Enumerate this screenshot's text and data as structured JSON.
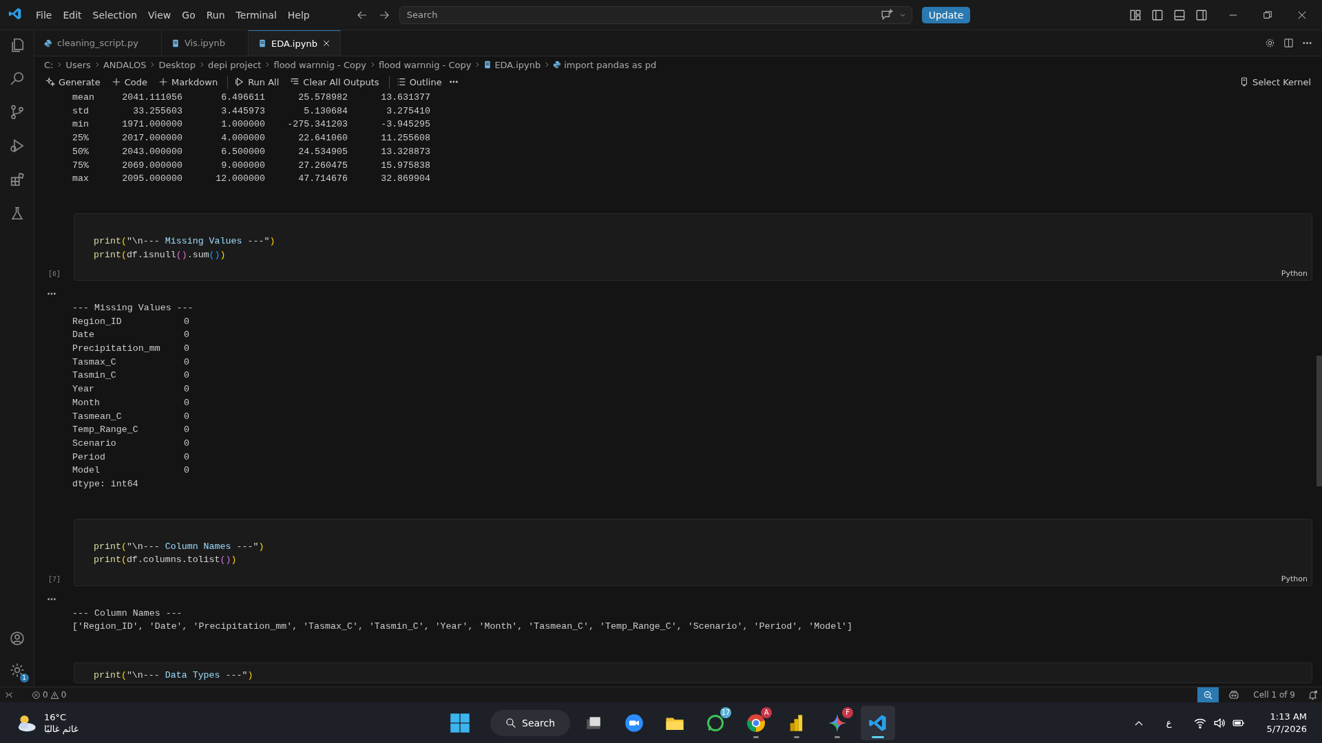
{
  "title_bar": {
    "menus": [
      "File",
      "Edit",
      "Selection",
      "View",
      "Go",
      "Run",
      "Terminal",
      "Help"
    ],
    "search": {
      "placeholder": "Search"
    },
    "update_button": "Update"
  },
  "activity_bar": {
    "items": [
      {
        "kind": "files",
        "selected": false
      },
      {
        "kind": "search",
        "selected": false
      },
      {
        "kind": "source-control",
        "selected": false
      },
      {
        "kind": "run-debug",
        "selected": false
      },
      {
        "kind": "extensions",
        "selected": false
      },
      {
        "kind": "testing",
        "selected": false
      }
    ],
    "settings_badge": "1"
  },
  "tabs": [
    {
      "label": "cleaning_script.py",
      "kind": "python",
      "selected": false
    },
    {
      "label": "Vis.ipynb",
      "kind": "notebook",
      "selected": false
    },
    {
      "label": "EDA.ipynb",
      "kind": "notebook",
      "selected": true
    }
  ],
  "breadcrumbs": [
    {
      "label": "C:",
      "kind": "folder"
    },
    {
      "label": "Users",
      "kind": "folder"
    },
    {
      "label": "ANDALOS",
      "kind": "folder"
    },
    {
      "label": "Desktop",
      "kind": "folder"
    },
    {
      "label": "depi project",
      "kind": "folder"
    },
    {
      "label": "flood warnnig - Copy",
      "kind": "folder"
    },
    {
      "label": "flood warnnig - Copy",
      "kind": "folder"
    },
    {
      "label": "EDA.ipynb",
      "kind": "notebook"
    },
    {
      "label": "import pandas as pd",
      "kind": "python"
    }
  ],
  "toolbar": [
    {
      "label": "Generate",
      "kind": "sparkle"
    },
    {
      "label": "Code",
      "kind": "plus"
    },
    {
      "label": "Markdown",
      "kind": "plus"
    },
    {
      "label": "Run All",
      "kind": "run",
      "divider": true
    },
    {
      "label": "Clear All Outputs",
      "kind": "clear"
    },
    {
      "label": "Outline",
      "kind": "list",
      "divider": true
    }
  ],
  "kernel_button": "Select Kernel",
  "notebook": [
    {
      "kind": "table_output",
      "rows": [
        [
          "mean",
          "2041.111056",
          "6.496611",
          "25.578982",
          "13.631377"
        ],
        [
          "std",
          "33.255603",
          "3.445973",
          "5.130684",
          "3.275410"
        ],
        [
          "min",
          "1971.000000",
          "1.000000",
          "-275.341203",
          "-3.945295"
        ],
        [
          "25%",
          "2017.000000",
          "4.000000",
          "22.641060",
          "11.255608"
        ],
        [
          "50%",
          "2043.000000",
          "6.500000",
          "24.534905",
          "13.328873"
        ],
        [
          "75%",
          "2069.000000",
          "9.000000",
          "27.260475",
          "15.975838"
        ],
        [
          "max",
          "2095.000000",
          "12.000000",
          "47.714676",
          "32.869904"
        ]
      ]
    },
    {
      "kind": "code",
      "count": "[6]",
      "language": "Python",
      "lines": [
        [
          {
            "text": "print",
            "kind": "func"
          },
          {
            "text": "(",
            "kind": "bracket"
          },
          {
            "text": "\"\\n--- ",
            "kind": "string"
          },
          {
            "text": "Missing Values",
            "kind": "var"
          },
          {
            "text": " ---\"",
            "kind": "string"
          },
          {
            "text": ")",
            "kind": "bracket"
          }
        ],
        [
          {
            "text": "print",
            "kind": "func"
          },
          {
            "text": "(",
            "kind": "bracket"
          },
          {
            "text": "df.isnull",
            "kind": "plain"
          },
          {
            "text": "()",
            "kind": "bracket2"
          },
          {
            "text": ".sum",
            "kind": "plain"
          },
          {
            "text": "()",
            "kind": "bracket3"
          },
          {
            "text": ")",
            "kind": "bracket"
          }
        ]
      ]
    },
    {
      "kind": "pairs_output",
      "header": "--- Missing Values ---",
      "rows": [
        [
          "Region_ID",
          "0"
        ],
        [
          "Date",
          "0"
        ],
        [
          "Precipitation_mm",
          "0"
        ],
        [
          "Tasmax_C",
          "0"
        ],
        [
          "Tasmin_C",
          "0"
        ],
        [
          "Year",
          "0"
        ],
        [
          "Month",
          "0"
        ],
        [
          "Tasmean_C",
          "0"
        ],
        [
          "Temp_Range_C",
          "0"
        ],
        [
          "Scenario",
          "0"
        ],
        [
          "Period",
          "0"
        ],
        [
          "Model",
          "0"
        ]
      ],
      "footer": "dtype: int64"
    },
    {
      "kind": "code",
      "count": "[7]",
      "language": "Python",
      "lines": [
        [
          {
            "text": "print",
            "kind": "func"
          },
          {
            "text": "(",
            "kind": "bracket"
          },
          {
            "text": "\"\\n--- ",
            "kind": "string"
          },
          {
            "text": "Column Names",
            "kind": "var"
          },
          {
            "text": " ---\"",
            "kind": "string"
          },
          {
            "text": ")",
            "kind": "bracket"
          }
        ],
        [
          {
            "text": "print",
            "kind": "func"
          },
          {
            "text": "(",
            "kind": "bracket"
          },
          {
            "text": "df.columns.tolist",
            "kind": "plain"
          },
          {
            "text": "()",
            "kind": "bracket2"
          },
          {
            "text": ")",
            "kind": "bracket"
          }
        ]
      ]
    },
    {
      "kind": "text_output",
      "lines": [
        "--- Column Names ---",
        "['Region_ID', 'Date', 'Precipitation_mm', 'Tasmax_C', 'Tasmin_C', 'Year', 'Month', 'Tasmean_C', 'Temp_Range_C', 'Scenario', 'Period', 'Model']"
      ]
    },
    {
      "kind": "code",
      "lines": [
        [
          {
            "text": "print",
            "kind": "func"
          },
          {
            "text": "(",
            "kind": "bracket"
          },
          {
            "text": "\"\\n--- ",
            "kind": "string"
          },
          {
            "text": "Data Types",
            "kind": "var"
          },
          {
            "text": " ---\"",
            "kind": "string"
          },
          {
            "text": ")",
            "kind": "bracket"
          }
        ]
      ]
    }
  ],
  "status_bar": {
    "errors": "0",
    "warnings": "0",
    "cell_position": "Cell 1 of 9"
  },
  "taskbar": {
    "weather": {
      "temperature": "16°C",
      "condition": "غائم غالبًا"
    },
    "search": "Search",
    "apps": [
      {
        "kind": "task-view",
        "running": false,
        "selected": false
      },
      {
        "kind": "zoom",
        "running": false,
        "selected": false
      },
      {
        "kind": "folder",
        "running": false,
        "selected": false
      },
      {
        "kind": "whatsapp",
        "badge_text": "17",
        "running": false,
        "selected": false
      },
      {
        "kind": "chrome",
        "badge_text": "A",
        "running": true,
        "selected": false
      },
      {
        "kind": "powerbi",
        "running": true,
        "selected": false
      },
      {
        "kind": "gemini",
        "badge_text": "F",
        "running": true,
        "selected": false
      },
      {
        "kind": "vscode",
        "running": true,
        "selected": true
      }
    ],
    "language": "ع",
    "time": "1:13 AM",
    "date": "5/7/2026"
  }
}
